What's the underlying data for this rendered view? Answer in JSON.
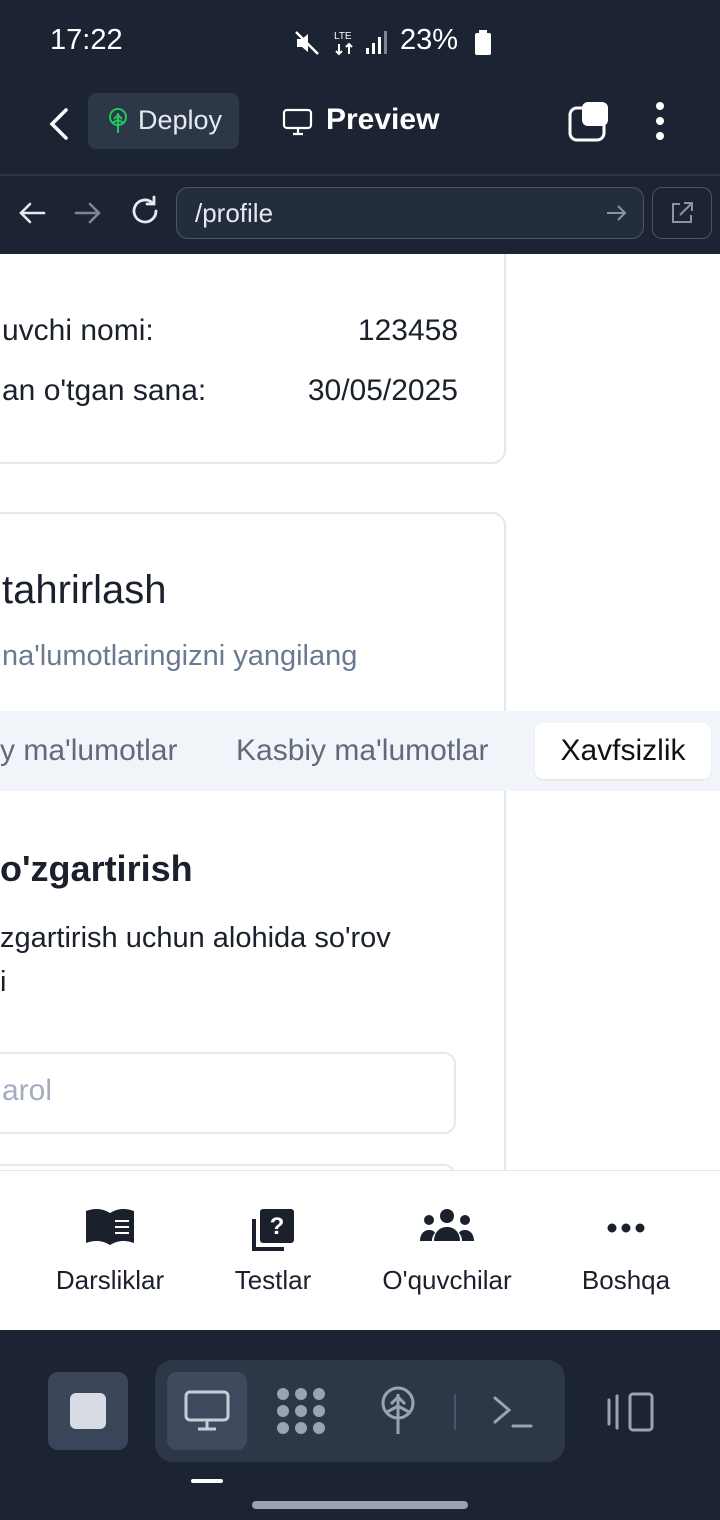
{
  "status_bar": {
    "time": "17:22",
    "battery": "23%"
  },
  "app_header": {
    "deploy_label": "Deploy",
    "preview_label": "Preview"
  },
  "url_bar": {
    "url": "/profile"
  },
  "profile_info": {
    "rows": [
      {
        "label": "uvchi nomi:",
        "value": "123458"
      },
      {
        "label": "an o'tgan sana:",
        "value": "30/05/2025"
      }
    ]
  },
  "edit_card": {
    "title": "tahrirlash",
    "subtitle": "na'lumotlaringizni yangilang",
    "tabs": [
      {
        "label": "y ma'lumotlar"
      },
      {
        "label": "Kasbiy ma'lumotlar"
      },
      {
        "label": "Xavfsizlik"
      }
    ],
    "password_section": {
      "title": "o'zgartirish",
      "description_line1": "zgartirish uchun alohida so'rov",
      "description_line2": "i",
      "input_placeholder": "arol"
    }
  },
  "bottom_nav": {
    "items": [
      {
        "label": "Darsliklar",
        "icon": "book-icon"
      },
      {
        "label": "Testlar",
        "icon": "quiz-icon"
      },
      {
        "label": "O'quvchilar",
        "icon": "people-icon"
      },
      {
        "label": "Boshqa",
        "icon": "more-horizontal-icon"
      }
    ]
  },
  "dev_toolbar": {
    "items": [
      "stop-icon",
      "desktop-icon",
      "dots-grid-icon",
      "deploy-tree-icon",
      "terminal-icon",
      "device-toggle-icon"
    ]
  }
}
